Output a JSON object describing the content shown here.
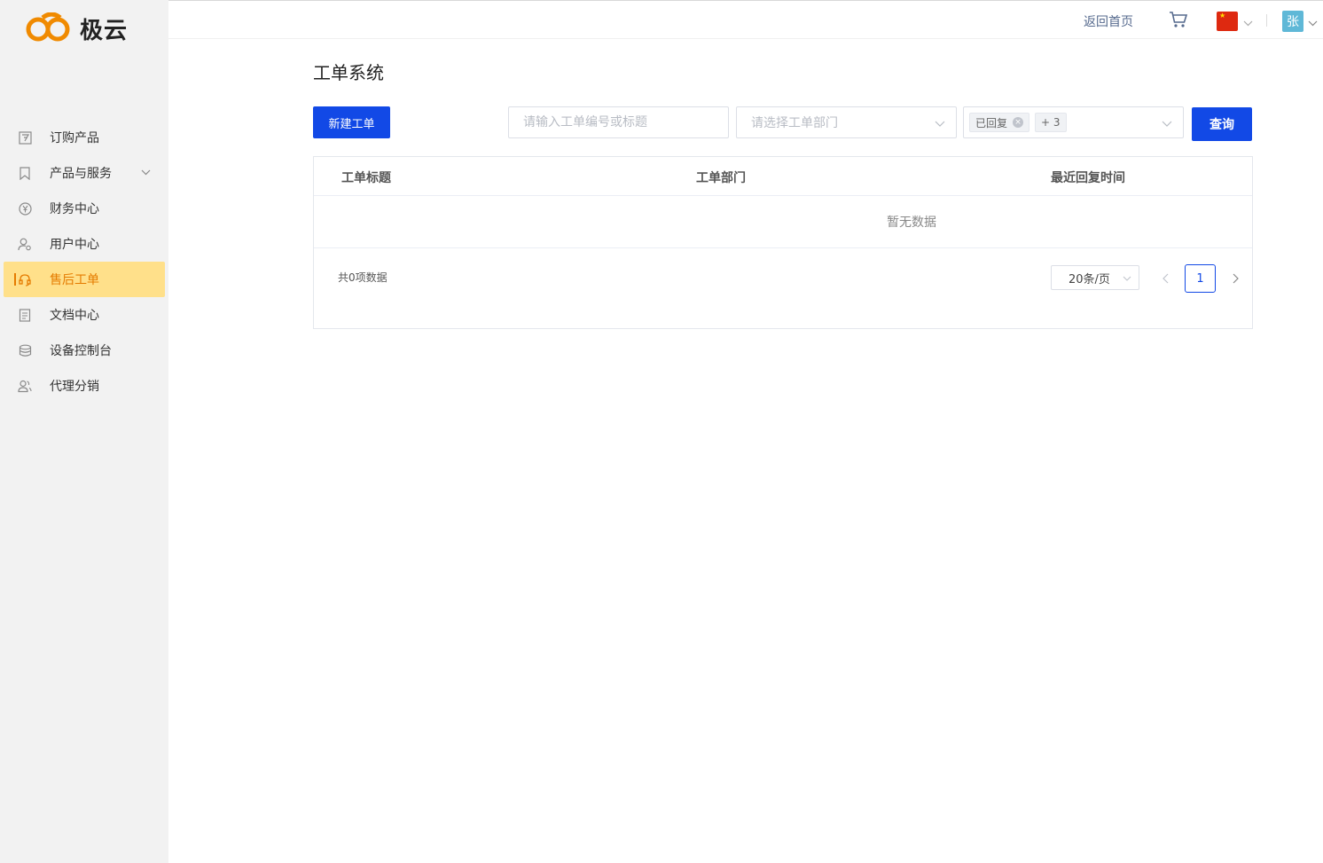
{
  "brand": {
    "name": "极云",
    "primary_color": "#1249e6",
    "logo_color": "#f08a00"
  },
  "sidebar": {
    "items": [
      {
        "label": "订购产品",
        "icon": "order-icon"
      },
      {
        "label": "产品与服务",
        "icon": "bookmark-icon",
        "has_submenu": true
      },
      {
        "label": "财务中心",
        "icon": "yuan-icon"
      },
      {
        "label": "用户中心",
        "icon": "user-settings-icon"
      },
      {
        "label": "售后工单",
        "icon": "headset-icon",
        "active": true
      },
      {
        "label": "文档中心",
        "icon": "document-icon"
      },
      {
        "label": "设备控制台",
        "icon": "database-icon"
      },
      {
        "label": "代理分销",
        "icon": "agent-icon"
      }
    ]
  },
  "header": {
    "home_link": "返回首页",
    "cart_icon": "cart-icon",
    "language_icon": "china-flag-icon",
    "avatar_text": "张"
  },
  "main": {
    "title": "工单系统",
    "new_button": "新建工单",
    "search": {
      "placeholder": "请输入工单编号或标题",
      "value": ""
    },
    "department": {
      "placeholder": "请选择工单部门"
    },
    "status": {
      "selected_tag": "已回复",
      "more_count": "+ 3"
    },
    "query_button": "查询"
  },
  "table": {
    "columns": [
      "工单标题",
      "工单部门",
      "最近回复时间"
    ],
    "rows": [],
    "empty_text": "暂无数据"
  },
  "pagination": {
    "total_text": "共0项数据",
    "page_size": "20条/页",
    "current_page": "1"
  }
}
